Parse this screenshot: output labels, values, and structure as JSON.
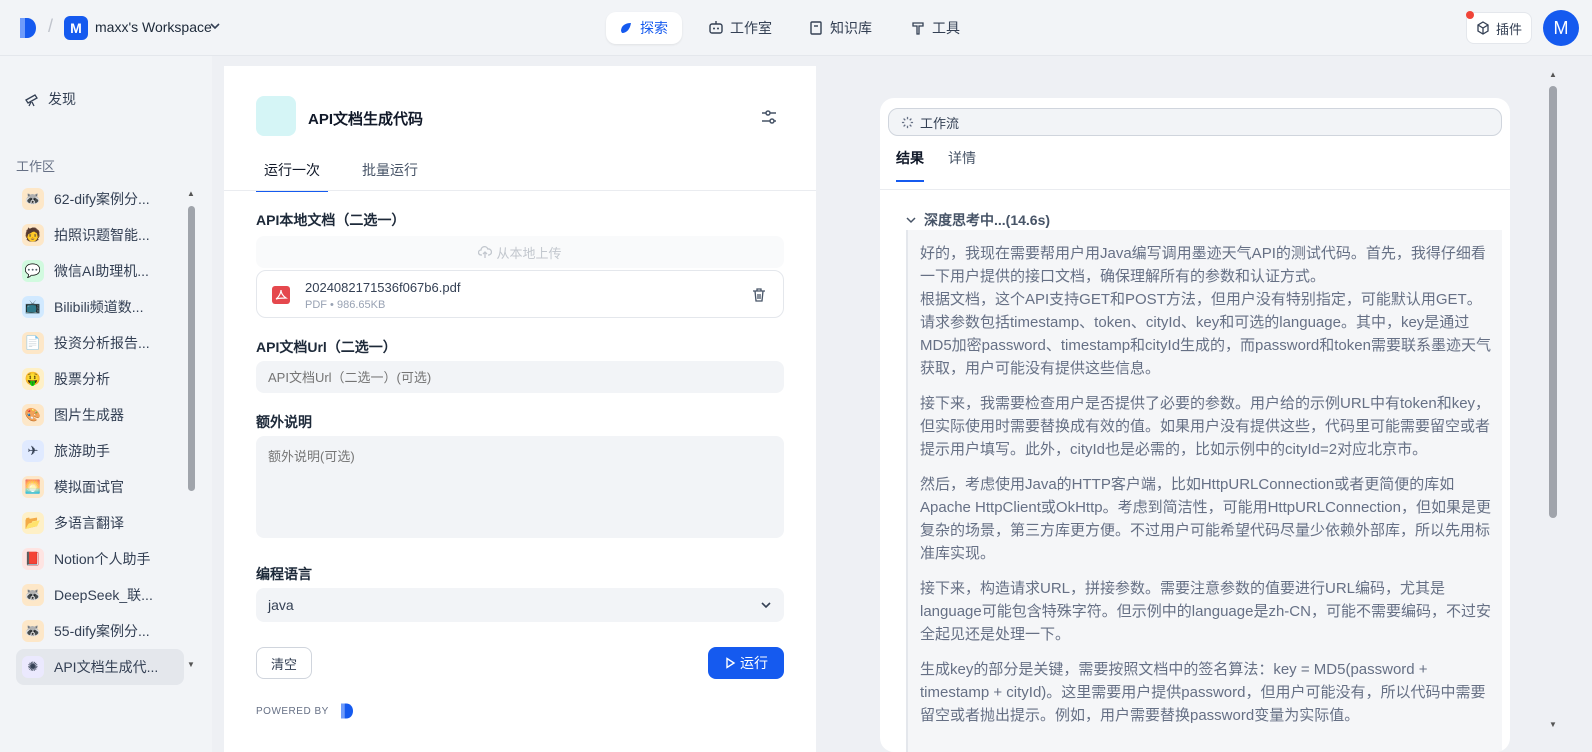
{
  "header": {
    "workspace_initial": "M",
    "workspace_name": "maxx's Workspace",
    "nav": [
      {
        "label": "探索",
        "active": true
      },
      {
        "label": "工作室",
        "active": false
      },
      {
        "label": "知识库",
        "active": false
      },
      {
        "label": "工具",
        "active": false
      }
    ],
    "plugin_label": "插件",
    "avatar_initial": "M"
  },
  "sidebar": {
    "discover_label": "发现",
    "section_label": "工作区",
    "apps": [
      {
        "label": "62-dify案例分...",
        "icon": "raccoon-icon",
        "bg": "#fde7c8",
        "glyph": "🦝"
      },
      {
        "label": "拍照识题智能...",
        "icon": "student-icon",
        "bg": "#fde7c8",
        "glyph": "🧑"
      },
      {
        "label": "微信AI助理机...",
        "icon": "chat-icon",
        "bg": "#d1fadf",
        "glyph": "💬"
      },
      {
        "label": "Bilibili频道数...",
        "icon": "tv-icon",
        "bg": "#d1e9ff",
        "glyph": "📺"
      },
      {
        "label": "投资分析报告...",
        "icon": "document-icon",
        "bg": "#fde7c8",
        "glyph": "📄"
      },
      {
        "label": "股票分析",
        "icon": "money-face-icon",
        "bg": "#fef0c7",
        "glyph": "🤑"
      },
      {
        "label": "图片生成器",
        "icon": "palette-icon",
        "bg": "#fde7c8",
        "glyph": "🎨"
      },
      {
        "label": "旅游助手",
        "icon": "airplane-icon",
        "bg": "#e0eaff",
        "glyph": "✈"
      },
      {
        "label": "模拟面试官",
        "icon": "sunrise-icon",
        "bg": "#fde7c8",
        "glyph": "🌅"
      },
      {
        "label": "多语言翻译",
        "icon": "folder-icon",
        "bg": "#fef0c7",
        "glyph": "📂"
      },
      {
        "label": "Notion个人助手",
        "icon": "book-icon",
        "bg": "#fee4e2",
        "glyph": "📕"
      },
      {
        "label": "DeepSeek_联...",
        "icon": "raccoon-icon",
        "bg": "#fde7c8",
        "glyph": "🦝"
      },
      {
        "label": "55-dify案例分...",
        "icon": "raccoon-icon",
        "bg": "#fde7c8",
        "glyph": "🦝"
      },
      {
        "label": "API文档生成代...",
        "icon": "sparkle-icon",
        "bg": "#ebe9fe",
        "glyph": "✺",
        "active": true
      }
    ]
  },
  "app": {
    "title": "API文档生成代码",
    "tabs": [
      {
        "label": "运行一次",
        "active": true
      },
      {
        "label": "批量运行",
        "active": false
      }
    ],
    "form": {
      "local_doc_label": "API本地文档（二选一）",
      "upload_label": "从本地上传",
      "file_name": "2024082171536f067b6.pdf",
      "file_meta": "PDF • 986.65KB",
      "url_label": "API文档Url（二选一）",
      "url_placeholder": "API文档Url（二选一）(可选)",
      "extra_label": "额外说明",
      "extra_placeholder": "额外说明(可选)",
      "lang_label": "编程语言",
      "lang_value": "java",
      "clear_label": "清空",
      "run_label": "运行"
    },
    "powered_by": "POWERED BY"
  },
  "result": {
    "workflow_label": "工作流",
    "tabs": [
      {
        "label": "结果",
        "active": true
      },
      {
        "label": "详情",
        "active": false
      }
    ],
    "thinking_label": "深度思考中...(14.6s)",
    "paragraphs": [
      "好的，我现在需要帮用户用Java编写调用墨迹天气API的测试代码。首先，我得仔细看一下用户提供的接口文档，确保理解所有的参数和认证方式。",
      "根据文档，这个API支持GET和POST方法，但用户没有特别指定，可能默认用GET。请求参数包括timestamp、token、cityId、key和可选的language。其中，key是通过MD5加密password、timestamp和cityId生成的，而password和token需要联系墨迹天气获取，用户可能没有提供这些信息。",
      "接下来，我需要检查用户是否提供了必要的参数。用户给的示例URL中有token和key，但实际使用时需要替换成有效的值。如果用户没有提供这些，代码里可能需要留空或者提示用户填写。此外，cityId也是必需的，比如示例中的cityId=2对应北京市。",
      "然后，考虑使用Java的HTTP客户端，比如HttpURLConnection或者更简便的库如Apache HttpClient或OkHttp。考虑到简洁性，可能用HttpURLConnection，但如果是更复杂的场景，第三方库更方便。不过用户可能希望代码尽量少依赖外部库，所以先用标准库实现。",
      "接下来，构造请求URL，拼接参数。需要注意参数的值要进行URL编码，尤其是language可能包含特殊字符。但示例中的language是zh-CN，可能不需要编码，不过安全起见还是处理一下。",
      "生成key的部分是关键，需要按照文档中的签名算法：key = MD5(password + timestamp + cityId)。这里需要用户提供password，但用户可能没有，所以代码中需要留空或者抛出提示。例如，用户需要替换password变量为实际值。"
    ]
  }
}
